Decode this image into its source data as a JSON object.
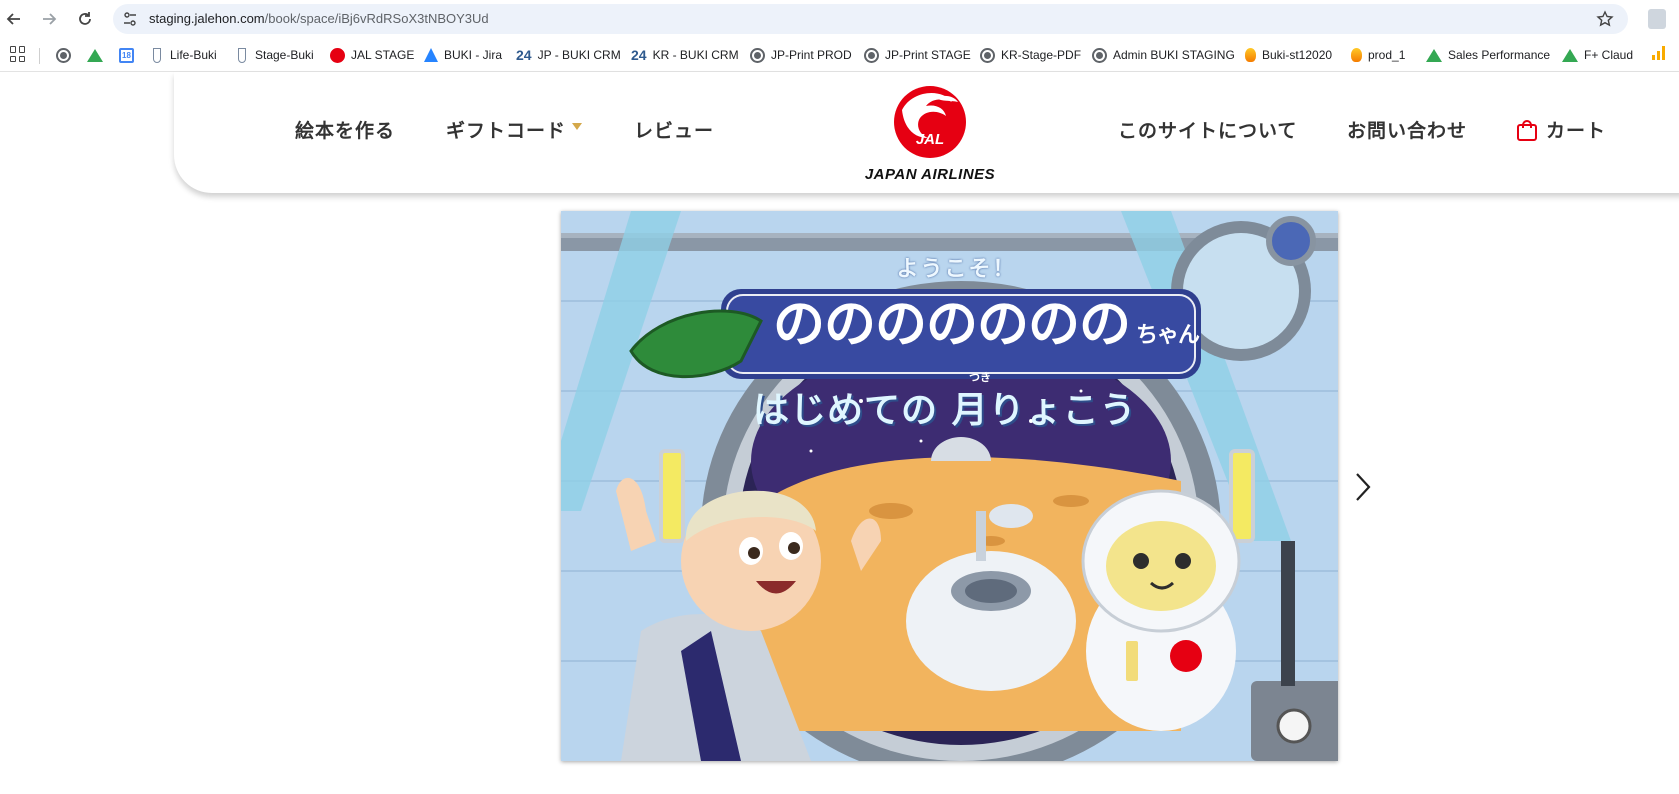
{
  "browser": {
    "url_domain": "staging.jalehon.com",
    "url_path": "/book/space/iBj6vRdRSoX3tNBOY3Ud",
    "icons": [
      "back-icon",
      "forward-icon",
      "reload-icon",
      "site-info-icon",
      "star-icon",
      "profile-icon"
    ]
  },
  "bookmarks": [
    {
      "label": "",
      "icon": "globe"
    },
    {
      "label": "",
      "icon": "gdrive"
    },
    {
      "label": "",
      "icon": "calendar",
      "badge": "18"
    },
    {
      "label": "Life-Buki",
      "icon": "tube"
    },
    {
      "label": "Stage-Buki",
      "icon": "tube"
    },
    {
      "label": "JAL STAGE",
      "icon": "jal"
    },
    {
      "label": "BUKI - Jira",
      "icon": "jira"
    },
    {
      "label": "JP - BUKI CRM",
      "icon": "b24"
    },
    {
      "label": "KR - BUKI CRM",
      "icon": "b24"
    },
    {
      "label": "JP-Print PROD",
      "icon": "globe"
    },
    {
      "label": "JP-Print STAGE",
      "icon": "globe"
    },
    {
      "label": "KR-Stage-PDF",
      "icon": "globe"
    },
    {
      "label": "Admin BUKI STAGING",
      "icon": "globe"
    },
    {
      "label": "Buki-st12020",
      "icon": "fire"
    },
    {
      "label": "prod_1",
      "icon": "fire"
    },
    {
      "label": "Sales Performance",
      "icon": "gdrive"
    },
    {
      "label": "F+ Claud",
      "icon": "gdrive"
    }
  ],
  "site": {
    "nav_left": [
      "絵本を作る",
      "ギフトコード",
      "レビュー"
    ],
    "nav_right": [
      "このサイトについて",
      "お問い合わせ",
      "カート"
    ],
    "logo_badge": "JAL",
    "logo_text": "JAPAN AIRLINES",
    "accent_color": "#e60012",
    "caret_color": "#d4a84a"
  },
  "book": {
    "welcome": "ようこそ！",
    "child_name": "ののののののの",
    "name_suffix": "ちゃん",
    "title_part1": "はじめての",
    "title_part2": "月りょこう",
    "ruby": "つき"
  }
}
